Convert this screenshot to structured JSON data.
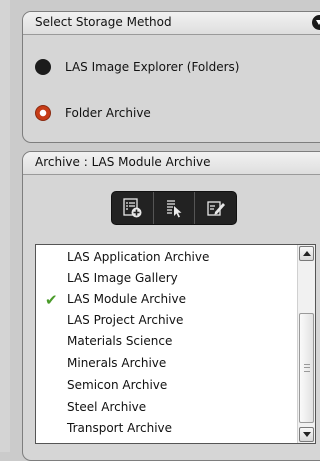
{
  "storage_panel": {
    "title": "Select Storage Method",
    "options": [
      {
        "label": "LAS Image Explorer (Folders)",
        "selected": false
      },
      {
        "label": "Folder Archive",
        "selected": true
      }
    ]
  },
  "archive_panel": {
    "title": "Archive : LAS Module Archive",
    "toolbar": {
      "buttons": [
        "new-archive-icon",
        "browse-archive-icon",
        "edit-archive-icon"
      ]
    },
    "list": {
      "items": [
        {
          "label": "LAS Application Archive",
          "checked": false
        },
        {
          "label": "LAS Image Gallery",
          "checked": false
        },
        {
          "label": "LAS Module Archive",
          "checked": true
        },
        {
          "label": "LAS Project Archive",
          "checked": false
        },
        {
          "label": "Materials Science",
          "checked": false
        },
        {
          "label": "Minerals Archive",
          "checked": false
        },
        {
          "label": "Semicon Archive",
          "checked": false
        },
        {
          "label": "Steel Archive",
          "checked": false
        },
        {
          "label": "Transport Archive",
          "checked": false
        }
      ],
      "check_color": "#4a9b2a"
    }
  },
  "colors": {
    "selected_radio": "#c63c17",
    "unselected_radio": "#1c1c1c",
    "toolbar_bg": "#222222"
  }
}
